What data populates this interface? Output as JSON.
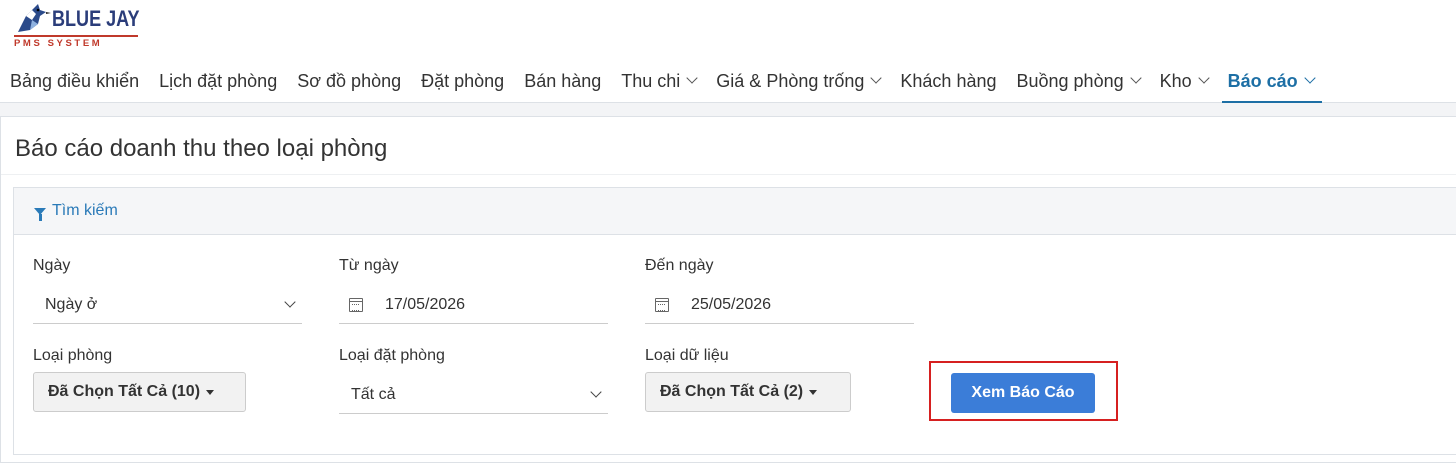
{
  "app": {
    "logo_title": "BLUE JAY",
    "logo_subtitle": "PMS SYSTEM"
  },
  "nav": {
    "items": [
      {
        "label": "Bảng điều khiển",
        "has_dropdown": false,
        "active": false
      },
      {
        "label": "Lịch đặt phòng",
        "has_dropdown": false,
        "active": false
      },
      {
        "label": "Sơ đồ phòng",
        "has_dropdown": false,
        "active": false
      },
      {
        "label": "Đặt phòng",
        "has_dropdown": false,
        "active": false
      },
      {
        "label": "Bán hàng",
        "has_dropdown": false,
        "active": false
      },
      {
        "label": "Thu chi",
        "has_dropdown": true,
        "active": false
      },
      {
        "label": "Giá & Phòng trống",
        "has_dropdown": true,
        "active": false
      },
      {
        "label": "Khách hàng",
        "has_dropdown": false,
        "active": false
      },
      {
        "label": "Buồng phòng",
        "has_dropdown": true,
        "active": false
      },
      {
        "label": "Kho",
        "has_dropdown": true,
        "active": false
      },
      {
        "label": "Báo cáo",
        "has_dropdown": true,
        "active": true
      }
    ]
  },
  "page": {
    "title": "Báo cáo doanh thu theo loại phòng"
  },
  "search": {
    "title": "Tìm kiếm",
    "date_type": {
      "label": "Ngày",
      "value": "Ngày ở"
    },
    "from_date": {
      "label": "Từ ngày",
      "value": "17/05/2026"
    },
    "to_date": {
      "label": "Đến ngày",
      "value": "25/05/2026"
    },
    "room_type": {
      "label": "Loại phòng",
      "value": "Đã Chọn Tất Cả (10)"
    },
    "booking_type": {
      "label": "Loại đặt phòng",
      "value": "Tất cả"
    },
    "data_type": {
      "label": "Loại dữ liệu",
      "value": "Đã Chọn Tất Cả (2)"
    },
    "submit_label": "Xem Báo Cáo"
  },
  "colors": {
    "accent": "#1d6fa5",
    "primary_button": "#3b7dd8",
    "highlight_box": "#d62020",
    "logo_blue": "#2b3d7a",
    "logo_red": "#c0392b"
  },
  "icons": {
    "logo": "blue-jay-bird-icon",
    "search_header": "filter-icon",
    "date_fields": "calendar-icon",
    "dropdowns": "chevron-down-icon"
  }
}
